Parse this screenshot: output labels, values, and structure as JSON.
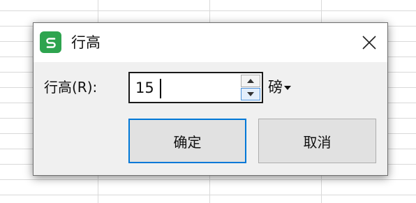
{
  "dialog": {
    "title": "行高",
    "app_icon": "wps-spreadsheet-icon",
    "close_icon": "close-icon",
    "field_label": "行高(R):",
    "field_value": "15",
    "unit": "磅",
    "spin_up_icon": "spin-up-arrow-icon",
    "spin_down_icon": "spin-down-arrow-icon",
    "unit_dropdown_icon": "dropdown-arrow-icon",
    "ok_label": "确定",
    "cancel_label": "取消"
  },
  "colors": {
    "app_icon_bg": "#2ea44f",
    "focus_border": "#0078d7",
    "dialog_bg": "#f0f0f0"
  }
}
